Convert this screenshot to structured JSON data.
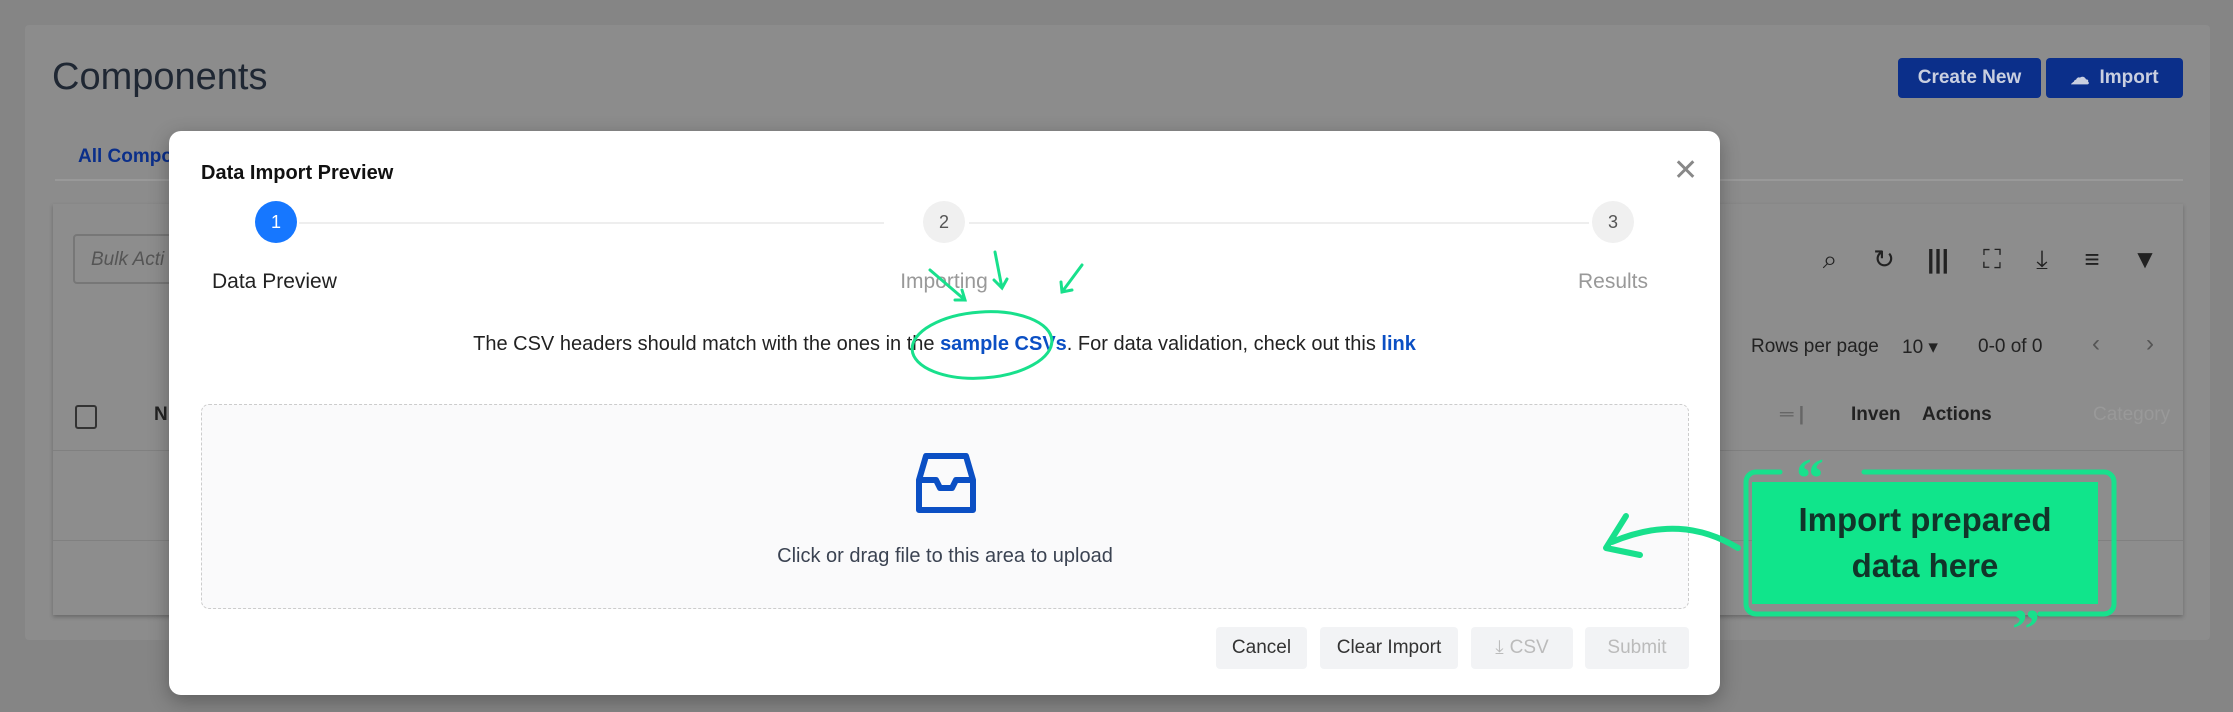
{
  "page": {
    "title": "Components",
    "create_new": "Create New",
    "import": "Import",
    "tab": "All Compo"
  },
  "table": {
    "bulk_placeholder": "Bulk Acti",
    "toolbar_icons": [
      "search-icon",
      "refresh-icon",
      "columns-icon",
      "fullscreen-icon",
      "download-icon",
      "density-icon",
      "filter-icon"
    ],
    "rows_per_page_label": "Rows per page",
    "rows_per_page": "10",
    "range": "0-0 of 0",
    "headers": [
      "N",
      "Inven",
      "Actions",
      "Category"
    ]
  },
  "modal": {
    "title": "Data Import Preview",
    "steps": [
      {
        "num": "1",
        "label": "Data Preview",
        "active": true
      },
      {
        "num": "2",
        "label": "Importing",
        "active": false
      },
      {
        "num": "3",
        "label": "Results",
        "active": false
      }
    ],
    "info_before": "The CSV headers should match with the ones in the ",
    "info_link1": "sample CSVs",
    "info_middle": ". For data validation, check out this ",
    "info_link2": "link",
    "drop_text": "Click or drag file to this area to upload",
    "buttons": {
      "cancel": "Cancel",
      "clear": "Clear Import",
      "csv": "CSV",
      "submit": "Submit"
    }
  },
  "annotation": {
    "line1": "Import prepared",
    "line2": "data here",
    "color": "#10e58b"
  },
  "colors": {
    "primary": "#0b2f8a",
    "step_active": "#1677ff",
    "link": "#0b4fc4"
  }
}
